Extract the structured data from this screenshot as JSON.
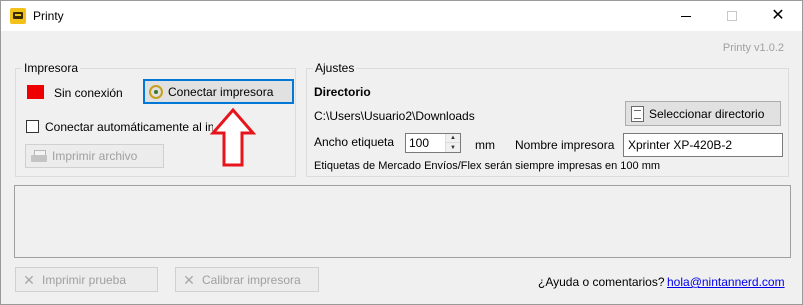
{
  "window": {
    "title": "Printy",
    "version": "Printy v1.0.2"
  },
  "printer_group": {
    "legend": "Impresora",
    "status": "Sin conexión",
    "status_color": "#ee0000",
    "connect_button": "Conectar impresora",
    "auto_connect_label": "Conectar automáticamente al inicio",
    "auto_connect_checked": false,
    "print_file_button": "Imprimir archivo"
  },
  "settings_group": {
    "legend": "Ajustes",
    "directory_title": "Directorio",
    "directory_path": "C:\\Users\\Usuario2\\Downloads",
    "select_dir_button": "Seleccionar directorio",
    "label_width_label": "Ancho etiqueta",
    "label_width_value": "100",
    "label_width_unit": "mm",
    "printer_name_label": "Nombre impresora",
    "printer_name_value": "Xprinter XP-420B-2",
    "note": "Etiquetas de Mercado Envíos/Flex serán siempre impresas en 100 mm"
  },
  "footer": {
    "test_print_button": "Imprimir prueba",
    "calibrate_button": "Calibrar impresora",
    "help_text": "¿Ayuda o comentarios?",
    "help_email": "hola@nintannerd.com"
  },
  "icons": {
    "app": "printy-app-icon",
    "connect": "plug-icon",
    "print_file": "printer-icon",
    "select_dir": "document-icon",
    "test_print": "wrench-icon",
    "calibrate": "wrench-icon"
  },
  "colors": {
    "focus": "#0078d7",
    "link": "#0000ee",
    "annotation_arrow": "#e8141b"
  }
}
